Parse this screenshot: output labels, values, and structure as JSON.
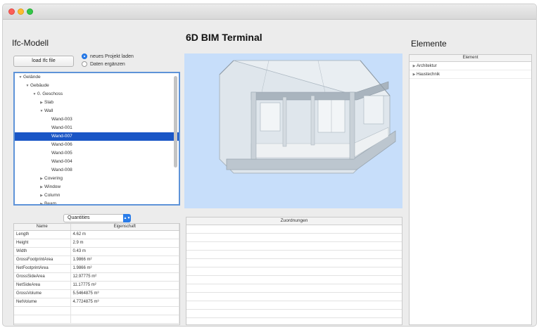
{
  "left_panel": {
    "title": "Ifc-Modell",
    "load_button": "load Ifc file",
    "radio_options": [
      {
        "label": "neues Projekt laden",
        "selected": true
      },
      {
        "label": "Daten ergänzen",
        "selected": false
      }
    ],
    "tree": [
      {
        "label": "Gelände",
        "depth": 0,
        "toggle": "open"
      },
      {
        "label": "Gebäude",
        "depth": 1,
        "toggle": "open"
      },
      {
        "label": "0. Geschoss",
        "depth": 2,
        "toggle": "open"
      },
      {
        "label": "Slab",
        "depth": 3,
        "toggle": "closed"
      },
      {
        "label": "Wall",
        "depth": 3,
        "toggle": "open"
      },
      {
        "label": "Wand-003",
        "depth": 4,
        "toggle": "none"
      },
      {
        "label": "Wand-001",
        "depth": 4,
        "toggle": "none"
      },
      {
        "label": "Wand-007",
        "depth": 4,
        "toggle": "none",
        "selected": true
      },
      {
        "label": "Wand-006",
        "depth": 4,
        "toggle": "none"
      },
      {
        "label": "Wand-005",
        "depth": 4,
        "toggle": "none"
      },
      {
        "label": "Wand-004",
        "depth": 4,
        "toggle": "none"
      },
      {
        "label": "Wand-008",
        "depth": 4,
        "toggle": "none"
      },
      {
        "label": "Covering",
        "depth": 3,
        "toggle": "closed"
      },
      {
        "label": "Window",
        "depth": 3,
        "toggle": "closed"
      },
      {
        "label": "Column",
        "depth": 3,
        "toggle": "closed"
      },
      {
        "label": "Beam",
        "depth": 3,
        "toggle": "closed"
      }
    ],
    "quantity_select": "Quantities",
    "properties": {
      "headers": [
        "Name",
        "Eigenschaft"
      ],
      "rows": [
        [
          "Length",
          "4.62 m"
        ],
        [
          "Height",
          "2.9 m"
        ],
        [
          "Width",
          "0.43 m"
        ],
        [
          "GrossFootprintArea",
          "1.9866 m²"
        ],
        [
          "NetFootprintArea",
          "1.9866 m²"
        ],
        [
          "GrossSideArea",
          "12.97775 m²"
        ],
        [
          "NetSideArea",
          "11.17775 m²"
        ],
        [
          "GrossVolume",
          "5.5464875 m³"
        ],
        [
          "NetVolume",
          "4.7724875 m³"
        ]
      ]
    }
  },
  "center_panel": {
    "title": "6D BIM Terminal",
    "assignments_header": "Zuordnungen"
  },
  "right_panel": {
    "title": "Elemente",
    "table_header": "Element",
    "items": [
      "Architektur",
      "Haustechnik"
    ]
  },
  "colors": {
    "selection": "#1a56c6",
    "accent": "#2b7de9",
    "viewer_background": "#c7defa"
  }
}
